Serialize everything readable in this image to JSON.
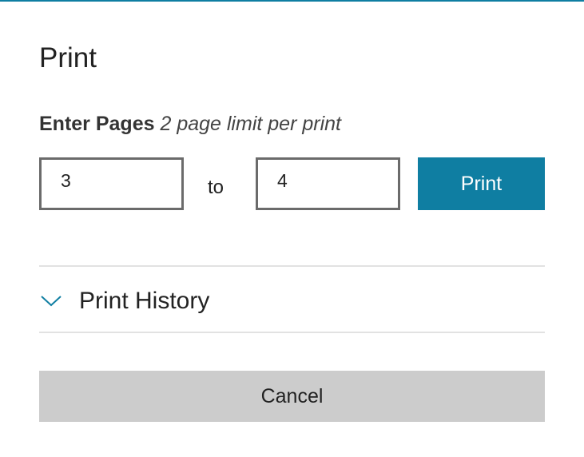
{
  "dialog": {
    "title": "Print",
    "instruction_bold": "Enter Pages",
    "instruction_italic": "2 page limit per print"
  },
  "range": {
    "from_value": "3",
    "to_label": "to",
    "to_value": "4"
  },
  "buttons": {
    "print_label": "Print",
    "cancel_label": "Cancel"
  },
  "history": {
    "label": "Print History",
    "icon": "chevron-down-icon"
  },
  "colors": {
    "accent": "#0f7ea2",
    "cancel_bg": "#cccccc",
    "divider": "#e2e2e2",
    "input_border": "#6b6b6b"
  }
}
